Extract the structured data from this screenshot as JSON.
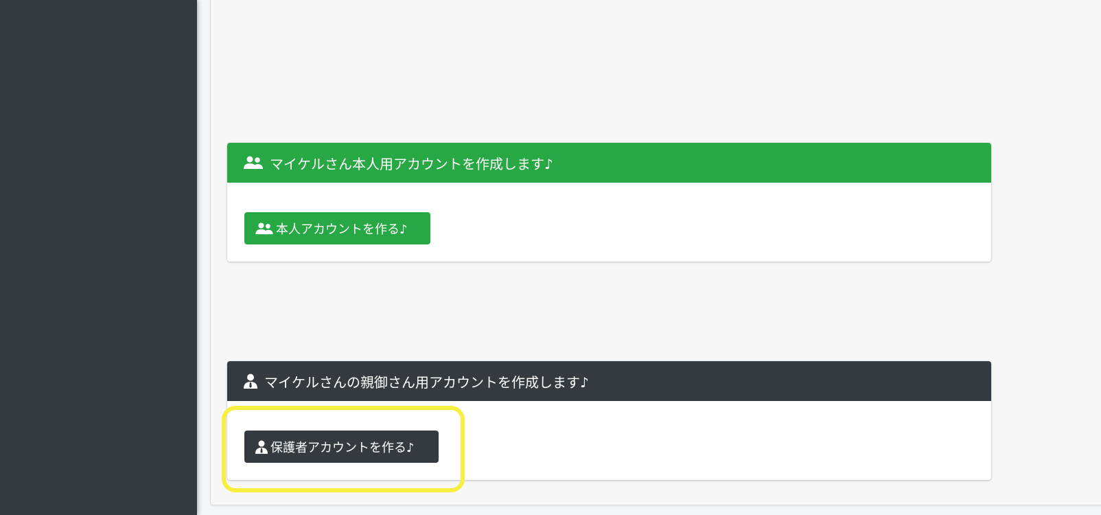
{
  "sidebar": {},
  "student_card": {
    "header_icon": "users-icon",
    "header_title": "マイケルさん本人用アカウントを作成します♪",
    "button_icon": "users-icon",
    "button_label": "本人アカウントを作る♪",
    "color": "#28a745"
  },
  "guardian_card": {
    "header_icon": "user-tie-icon",
    "header_title": "マイケルさんの親御さん用アカウントを作成します♪",
    "button_icon": "user-tie-icon",
    "button_label": "保護者アカウントを作る♪",
    "color": "#343a40"
  },
  "annotation": {
    "highlight_color": "#f7ef3f"
  }
}
